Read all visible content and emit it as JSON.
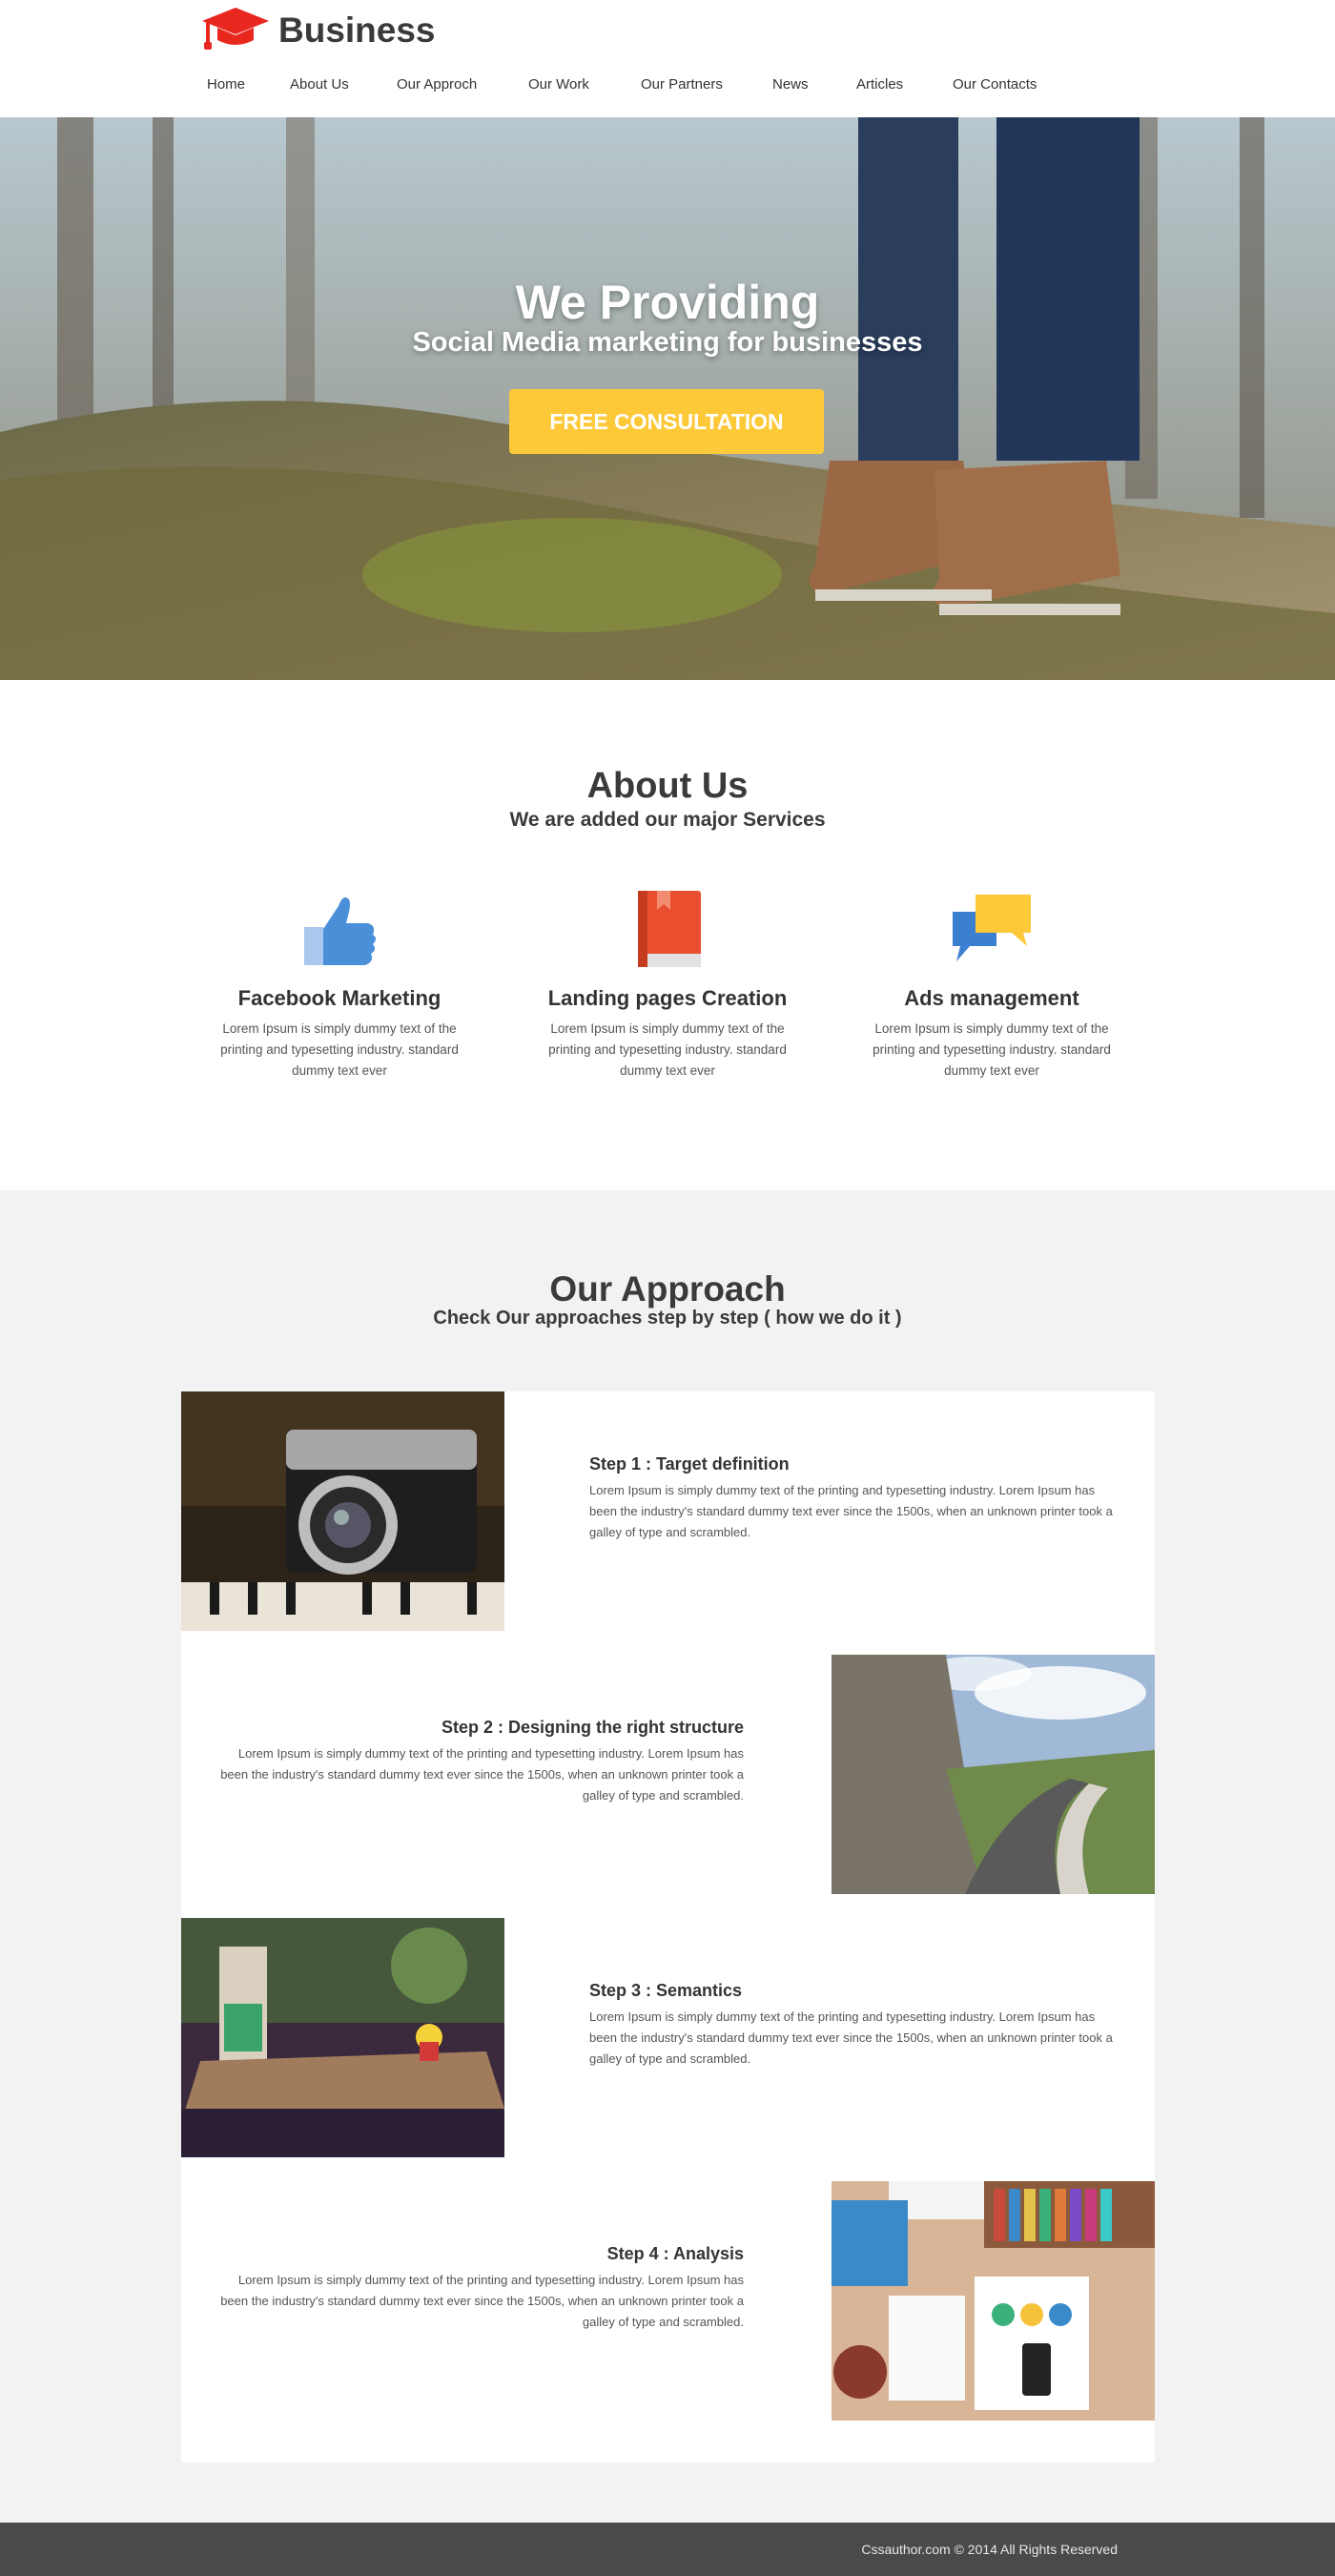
{
  "header": {
    "brand": "Business",
    "brand_color": "#e8281f"
  },
  "nav": [
    {
      "label": "Home"
    },
    {
      "label": "About Us"
    },
    {
      "label": "Our Approch"
    },
    {
      "label": "Our Work"
    },
    {
      "label": "Our Partners"
    },
    {
      "label": "News"
    },
    {
      "label": "Articles"
    },
    {
      "label": "Our Contacts"
    }
  ],
  "hero": {
    "title": "We Providing",
    "subtitle": "Social Media marketing for businesses",
    "button_label": "FREE CONSULTATION",
    "button_color": "#fdc938"
  },
  "about": {
    "title": "About Us",
    "subtitle": "We are added our major Services",
    "services": [
      {
        "icon": "thumbs-up-icon",
        "title": "Facebook Marketing",
        "desc": "Lorem Ipsum is simply dummy text of the printing and typesetting industry. standard dummy text ever"
      },
      {
        "icon": "book-icon",
        "title": "Landing pages Creation",
        "desc": "Lorem Ipsum is simply dummy text of the printing and typesetting industry. standard dummy text ever"
      },
      {
        "icon": "chat-bubbles-icon",
        "title": "Ads management",
        "desc": "Lorem Ipsum is simply dummy text of the printing and typesetting industry. standard dummy text ever"
      }
    ]
  },
  "approach": {
    "title": "Our Approach",
    "subtitle": "Check Our approaches step by step ( how we do it )",
    "steps": [
      {
        "title": "Step 1 : Target definition",
        "desc": "Lorem Ipsum is simply dummy text of the printing and typesetting industry. Lorem Ipsum has been the industry's standard dummy text ever since the 1500s, when an unknown printer took a galley of type and scrambled.",
        "image": "camera-photo"
      },
      {
        "title": "Step 2 : Designing the right structure",
        "desc": "Lorem Ipsum is simply dummy text of the printing and typesetting industry. Lorem Ipsum has been the industry's standard dummy text ever since the 1500s, when an unknown printer took a galley of type and scrambled.",
        "image": "mountain-road-photo"
      },
      {
        "title": "Step 3 : Semantics",
        "desc": "Lorem Ipsum is simply dummy text of the printing and typesetting industry. Lorem Ipsum has been the industry's standard dummy text ever since the 1500s, when an unknown printer took a galley of type and scrambled.",
        "image": "cafe-photo"
      },
      {
        "title": "Step 4 : Analysis",
        "desc": "Lorem Ipsum is simply dummy text of the printing and typesetting industry. Lorem Ipsum has been the industry's standard dummy text ever since the 1500s, when an unknown printer took a galley of type and scrambled.",
        "image": "desk-photo"
      }
    ]
  },
  "footer": {
    "copyright": "Cssauthor.com © 2014 All Rights Reserved"
  }
}
